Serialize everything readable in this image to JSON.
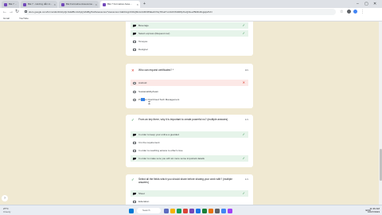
{
  "browser": {
    "tabs": [
      {
        "label": "Bài 7 ...",
        "icon_color": "#7248b9",
        "active": false
      },
      {
        "label": "Bài 7 - Hướng dẫn H...",
        "icon_color": "#7248b9",
        "active": false
      },
      {
        "label": "Bài Formative Assessme...",
        "icon_color": "#7248b9",
        "active": false
      },
      {
        "label": "Bài 7 Formative Asse...",
        "icon_color": "#7248b9",
        "active": true
      }
    ],
    "new_tab": "+",
    "url": "docs.google.com/forms/d/e/1FAIpQLSdwfBm4v6pQrtA3Bg7kA9viewscore?viewscore=AE0zAgCKfAQ8mH4nfMJ6SEwbVhq7lNu2Yxn0cFhM1R8pXwQ3tLeZ5bRk0GgHjsPvN",
    "bookmarks": [
      "Gmail",
      "YouTube"
    ],
    "window_controls": [
      "–",
      "▢",
      "✕"
    ]
  },
  "form": {
    "q1": {
      "options": [
        {
          "label": "Beverage",
          "type": "checkbox",
          "checked": true,
          "state": "correct"
        },
        {
          "label": "Select express (Request row)",
          "type": "checkbox",
          "checked": true,
          "state": "correct"
        },
        {
          "label": "Toneyou",
          "type": "checkbox",
          "checked": false,
          "state": "none"
        },
        {
          "label": "Designer",
          "type": "checkbox",
          "checked": false,
          "state": "none"
        }
      ]
    },
    "q2": {
      "title": "Who can request certificates? *",
      "score": "0/1",
      "options": [
        {
          "label": "Android",
          "type": "radio",
          "state": "wrong"
        },
        {
          "label": "Sustainability/team",
          "type": "radio",
          "state": "none"
        },
        {
          "label": "Pro Dev Ops/Cloud Tech Management",
          "type": "radio",
          "state": "none"
        }
      ]
    },
    "q3": {
      "title": "From an key there, why it is important to create powerful no? (multiple answers)",
      "score": "1/1",
      "options": [
        {
          "label": "In order to keep your online a guarded",
          "type": "checkbox",
          "checked": true,
          "state": "correct"
        },
        {
          "label": "It is the requirement",
          "type": "checkbox",
          "checked": false,
          "state": "none"
        },
        {
          "label": "In order to reaching access to other's love",
          "type": "checkbox",
          "checked": false,
          "state": "none"
        },
        {
          "label": "In order to make sure you will not more some important details",
          "type": "checkbox",
          "checked": true,
          "state": "correct"
        }
      ]
    },
    "q4": {
      "title": "Select all the fields which you should share before sharing your work with? (multiple answers)",
      "score": "1/1",
      "options": [
        {
          "label": "Sheet",
          "type": "checkbox",
          "checked": true,
          "state": "correct"
        },
        {
          "label": "Education",
          "type": "checkbox",
          "checked": false,
          "state": "none"
        }
      ]
    }
  },
  "taskbar": {
    "weather_temp": "27°C",
    "weather_desc": "Cloudy",
    "search_label": "Search",
    "tray_lang": "ENG",
    "time": "11:36 AM",
    "date": "10/27/2023"
  },
  "colors": {
    "page_bg": "#f0e9d2",
    "correct_bg": "#e6f4ea",
    "wrong_bg": "#fce8e6",
    "accent": "#7248b9"
  }
}
